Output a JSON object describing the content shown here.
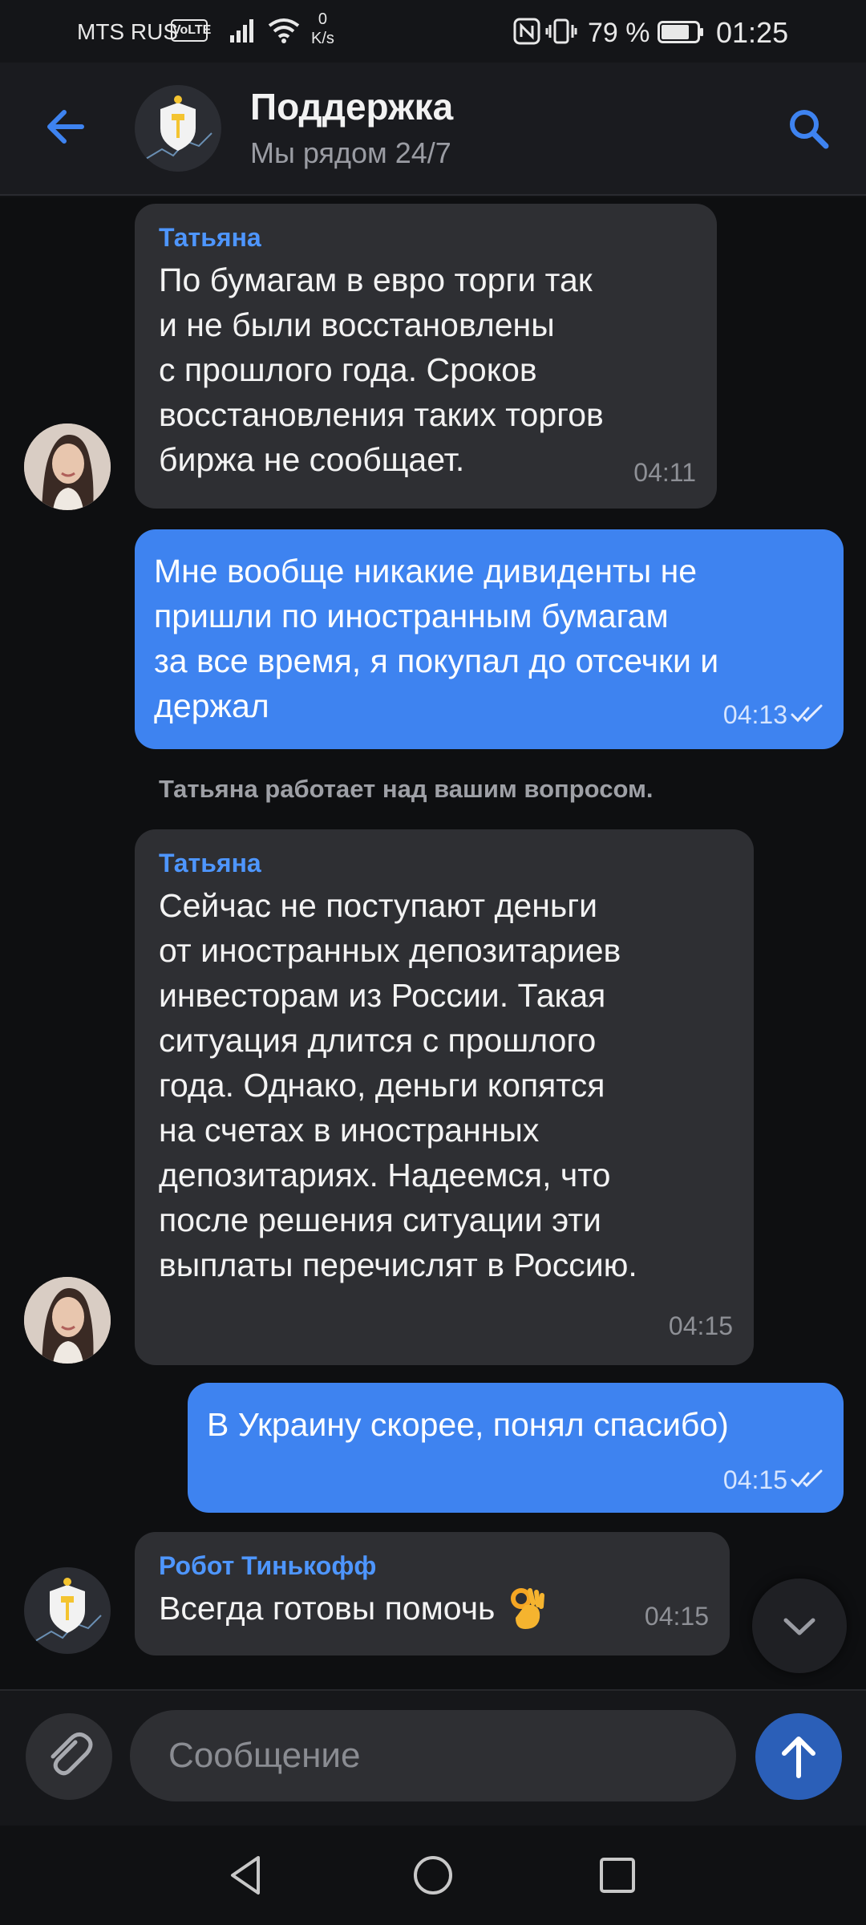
{
  "status_bar": {
    "carrier": "MTS RUS",
    "volte": "VoLTE",
    "net_speed_value": "0",
    "net_speed_unit": "K/s",
    "battery": "79 %",
    "battery_level": 0.79,
    "time": "01:25"
  },
  "header": {
    "title": "Поддержка",
    "subtitle": "Мы рядом 24/7",
    "back_icon": "arrow-left-icon",
    "search_icon": "search-icon"
  },
  "messages": [
    {
      "direction": "in",
      "sender": "Татьяна",
      "text": "По бумагам в евро торги так\nи не были восстановлены\nс прошлого года. Сроков\nвосстановления таких торгов\nбиржа не сообщает.",
      "time": "04:11"
    },
    {
      "direction": "out",
      "text": "Мне вообще никакие дивиденты не\nпришли по иностранным бумагам\nза все время, я покупал до отсечки и\nдержал",
      "time": "04:13"
    },
    {
      "direction": "in",
      "sender": "Татьяна",
      "text": "Сейчас не поступают деньги\nот иностранных депозитариев\nинвесторам из России. Такая\nситуация длится с прошлого\nгода. Однако, деньги копятся\nна счетах в иностранных\nдепозитариях. Надеемся, что\nпосле решения ситуации эти\nвыплаты перечислят в Россию.",
      "time": "04:15"
    },
    {
      "direction": "out",
      "text": "В Украину скорее, понял спасибо)",
      "time": "04:15"
    },
    {
      "direction": "in",
      "sender": "Робот Тинькофф",
      "text": "Всегда готовы помочь",
      "time": "04:15"
    }
  ],
  "system_note": "Татьяна работает над вашим вопросом.",
  "composer": {
    "placeholder": "Сообщение"
  },
  "colors": {
    "accent": "#3e83f0",
    "incoming_bubble": "#2e2f33",
    "sender_name": "#4e96ff"
  }
}
